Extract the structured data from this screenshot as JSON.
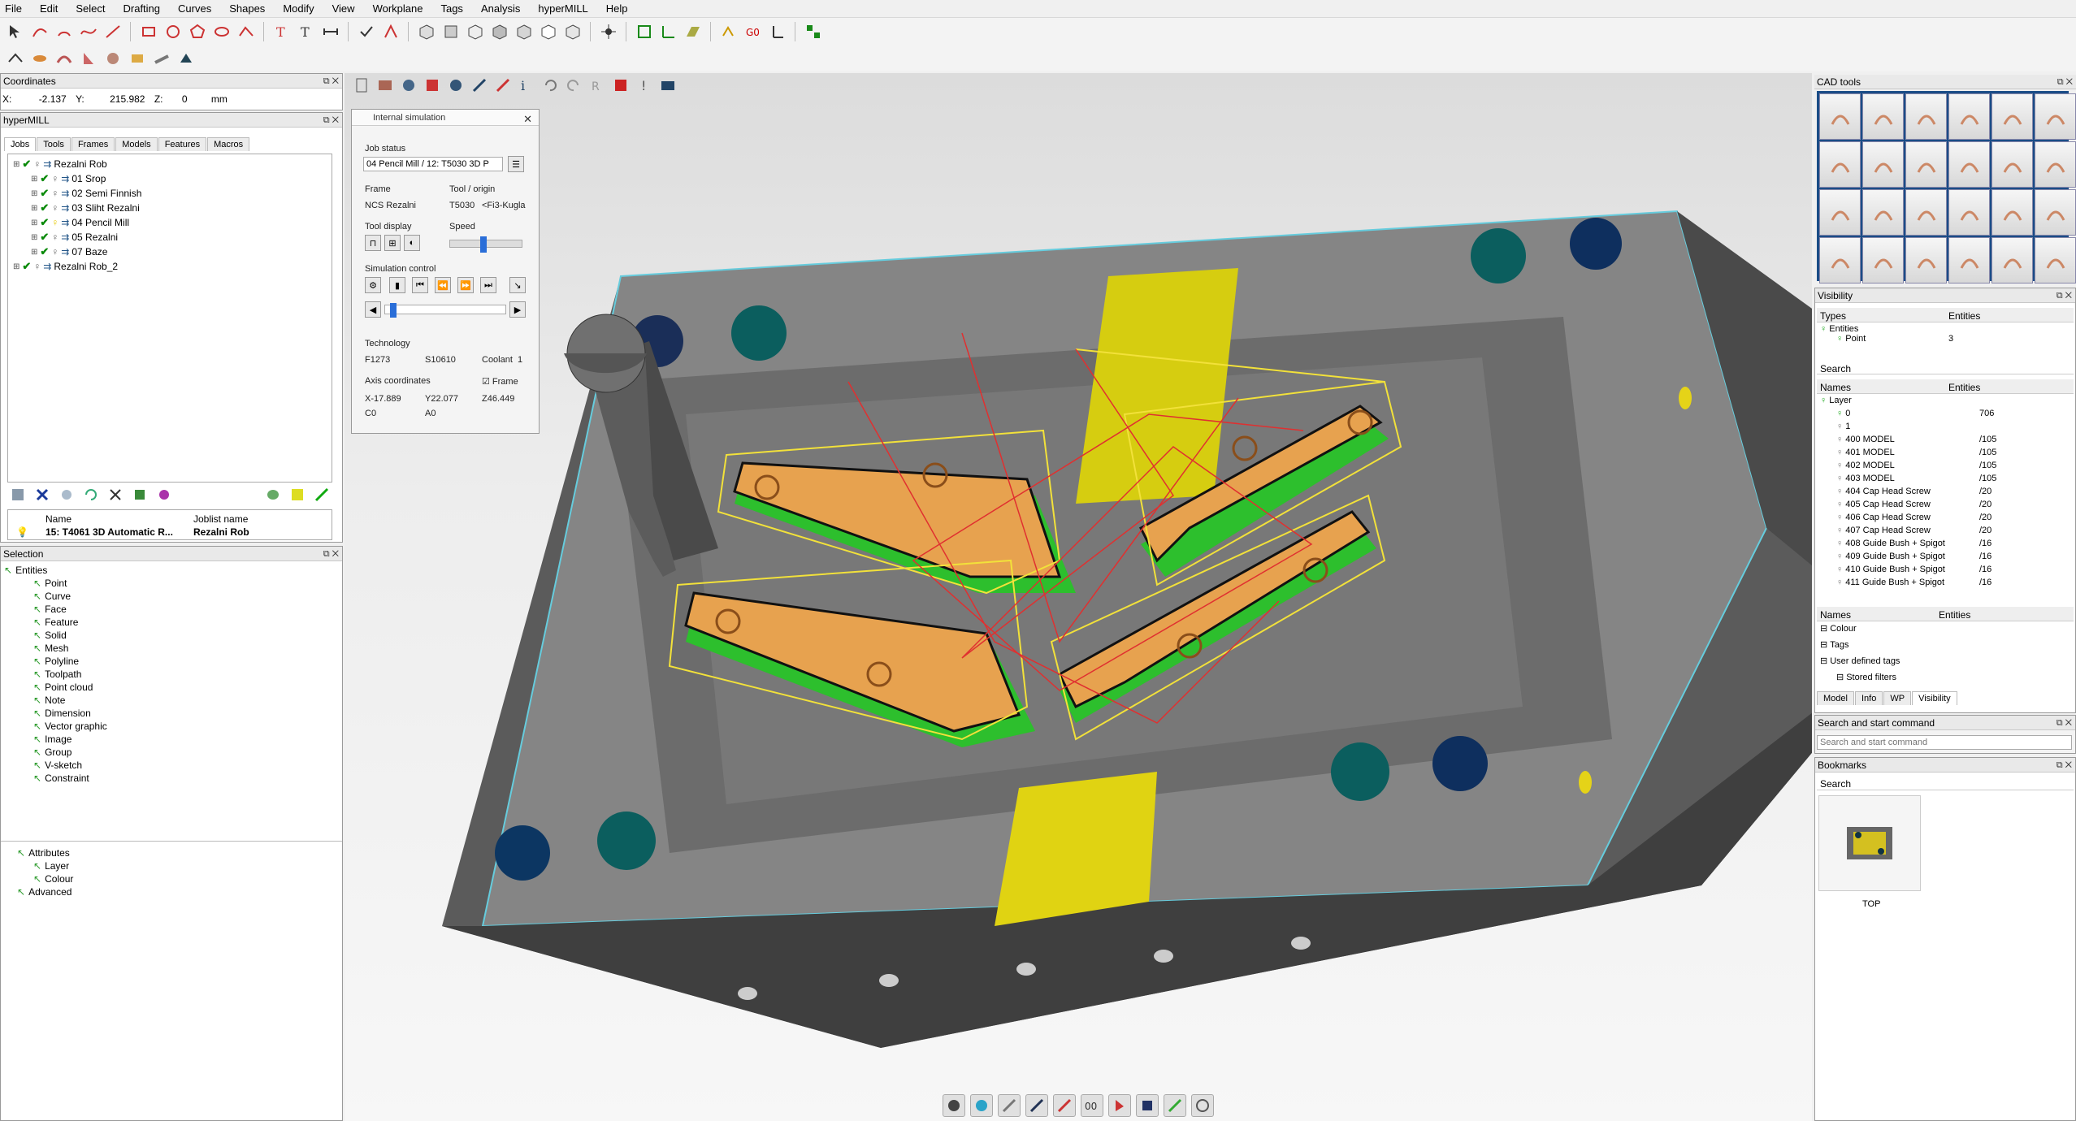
{
  "menu": [
    "File",
    "Edit",
    "Select",
    "Drafting",
    "Curves",
    "Shapes",
    "Modify",
    "View",
    "Workplane",
    "Tags",
    "Analysis",
    "hyperMILL",
    "Help"
  ],
  "coordinates": {
    "title": "Coordinates",
    "x_label": "X:",
    "x": "-2.137",
    "y_label": "Y:",
    "y": "215.982",
    "z_label": "Z:",
    "z": "0",
    "unit": "mm"
  },
  "hypermill": {
    "title": "hyperMILL",
    "tabs": [
      "Jobs",
      "Tools",
      "Frames",
      "Models",
      "Features",
      "Macros"
    ],
    "jobs": [
      {
        "label": "Rezalni Rob",
        "level": 0
      },
      {
        "label": "01 Srop",
        "level": 1
      },
      {
        "label": "02 Semi Finnish",
        "level": 1
      },
      {
        "label": "03 Sliht Rezalni",
        "level": 1
      },
      {
        "label": "04 Pencil Mill",
        "level": 1
      },
      {
        "label": "05 Rezalni",
        "level": 1
      },
      {
        "label": "07 Baze",
        "level": 1
      },
      {
        "label": "Rezalni Rob_2",
        "level": 0
      }
    ],
    "list_header_name": "Name",
    "list_header_joblist": "Joblist name",
    "list_row_name": "15: T4061 3D Automatic R...",
    "list_row_joblist": "Rezalni Rob"
  },
  "selection": {
    "title": "Selection",
    "items": [
      "Entities",
      "Point",
      "Curve",
      "Face",
      "Feature",
      "Solid",
      "Mesh",
      "Polyline",
      "Toolpath",
      "Point cloud",
      "Note",
      "Dimension",
      "Vector graphic",
      "Image",
      "Group",
      "V-sketch",
      "Constraint"
    ],
    "attr_items": [
      "Attributes",
      "Layer",
      "Colour",
      "Advanced"
    ]
  },
  "simulation": {
    "title": "Internal simulation",
    "job_status_label": "Job status",
    "job_status_value": "04 Pencil Mill / 12: T5030 3D P",
    "frame_label": "Frame",
    "frame_value": "NCS Rezalni",
    "tool_label": "Tool / origin",
    "tool_value": "T5030",
    "tool_origin": "<Fi3-Kugla",
    "tool_display_label": "Tool display",
    "speed_label": "Speed",
    "speed_level": 0.45,
    "sim_control_label": "Simulation control",
    "progress": 0.04,
    "technology_label": "Technology",
    "feed": "F1273",
    "spindle": "S10610",
    "coolant": "Coolant",
    "coolant_value": "1",
    "axis_label": "Axis coordinates",
    "frame_check": "Frame",
    "x": "X-17.889",
    "y": "Y22.077",
    "z": "Z46.449",
    "c": "C0",
    "a": "A0"
  },
  "cad_tools": {
    "title": "CAD tools"
  },
  "visibility": {
    "title": "Visibility",
    "types_header": "Types",
    "entities_header": "Entities",
    "types": [
      {
        "label": "Entities",
        "value": ""
      },
      {
        "label": "Point",
        "value": "3"
      }
    ],
    "search": "Search",
    "names_header": "Names",
    "layers": [
      {
        "label": "Layer",
        "value": ""
      },
      {
        "label": "0",
        "value": "706"
      },
      {
        "label": "1",
        "value": ""
      },
      {
        "label": "400 MODEL",
        "value": "/105"
      },
      {
        "label": "401 MODEL",
        "value": "/105"
      },
      {
        "label": "402 MODEL",
        "value": "/105"
      },
      {
        "label": "403 MODEL",
        "value": "/105"
      },
      {
        "label": "404 Cap Head Screw",
        "value": "/20"
      },
      {
        "label": "405 Cap Head Screw",
        "value": "/20"
      },
      {
        "label": "406 Cap Head Screw",
        "value": "/20"
      },
      {
        "label": "407 Cap Head Screw",
        "value": "/20"
      },
      {
        "label": "408 Guide Bush + Spigot",
        "value": "/16"
      },
      {
        "label": "409 Guide Bush + Spigot",
        "value": "/16"
      },
      {
        "label": "410 Guide Bush + Spigot",
        "value": "/16"
      },
      {
        "label": "411 Guide Bush + Spigot",
        "value": "/16"
      }
    ],
    "groups": [
      "Colour",
      "Tags",
      "User defined tags",
      "Stored filters"
    ],
    "bottom_tabs": [
      "Model",
      "Info",
      "WP",
      "Visibility"
    ]
  },
  "search_command": {
    "title": "Search and start command",
    "placeholder": "Search and start command"
  },
  "bookmarks": {
    "title": "Bookmarks",
    "search": "Search",
    "item_label": "TOP"
  },
  "colors": {
    "accent": "#1b4d87",
    "part": "#e7a24f",
    "toolpath_yellow": "#f2e13a",
    "toolpath_red": "#e03030",
    "mold": "#808080",
    "insert": "#d6d020"
  }
}
